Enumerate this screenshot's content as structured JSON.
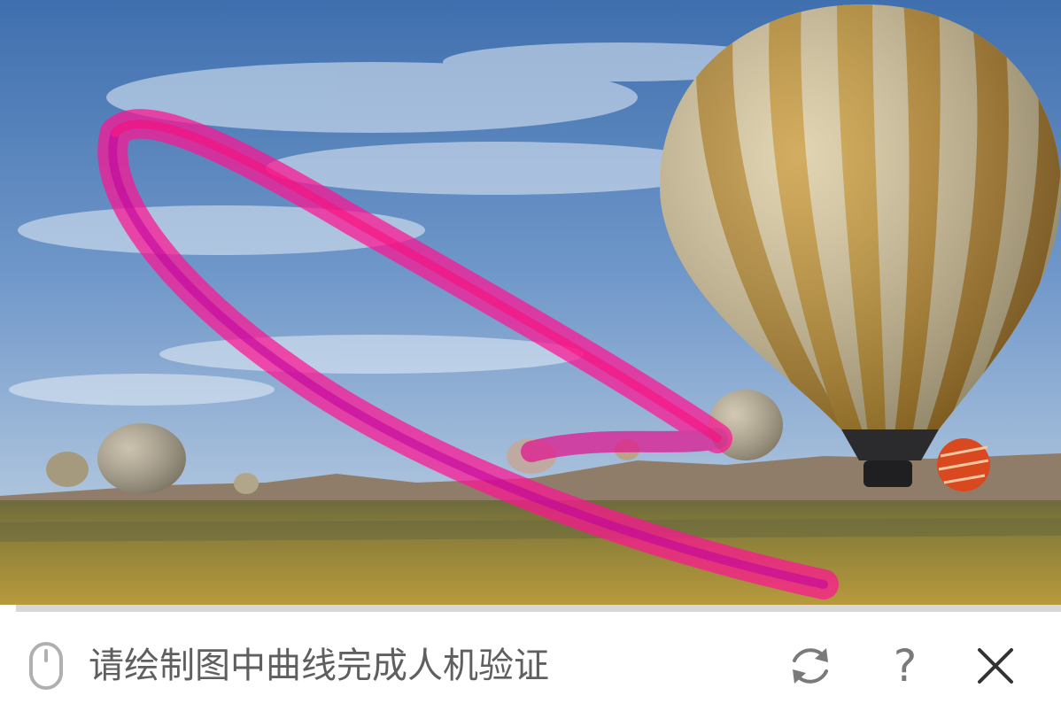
{
  "captcha": {
    "prompt_text": "请绘制图中曲线完成人机验证",
    "progress": 0.015,
    "curve_color": "#ff1493",
    "icons": {
      "mouse": "mouse-icon",
      "refresh": "refresh-icon",
      "help": "help-icon",
      "close": "close-icon"
    },
    "help_glyph": "?",
    "image_description_subjects": [
      "hot-air-balloons",
      "sky",
      "field"
    ]
  }
}
